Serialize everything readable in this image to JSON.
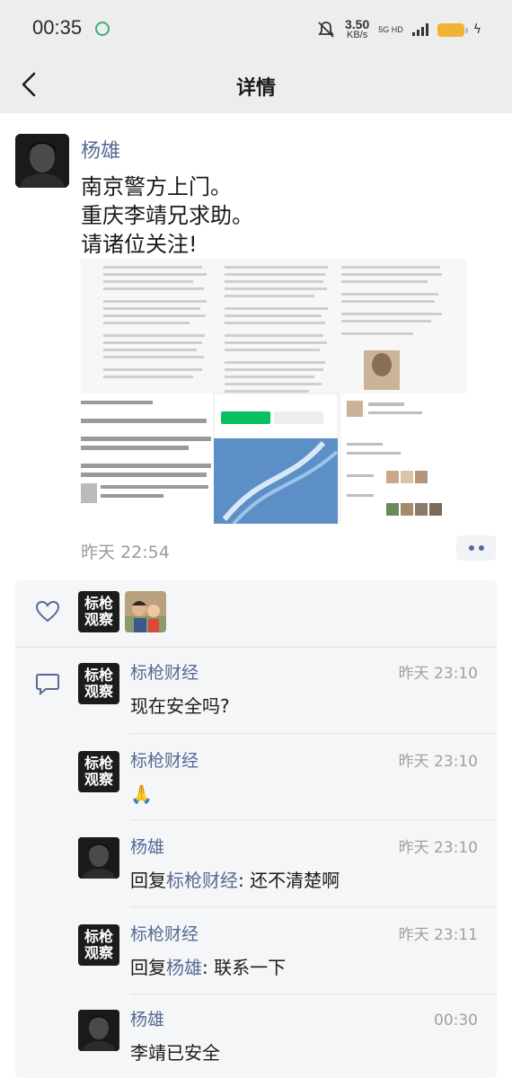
{
  "status_bar": {
    "time": "00:35",
    "net_speed": "3.50",
    "net_unit": "KB/s",
    "network": "5G HD"
  },
  "nav": {
    "title": "详情"
  },
  "post": {
    "author": "杨雄",
    "lines": [
      "南京警方上门。",
      "重庆李靖兄求助。",
      "请诸位关注!"
    ],
    "time": "昨天 22:54"
  },
  "likes": {
    "users": [
      "标枪观察",
      "family-photo"
    ]
  },
  "brand_avatar": {
    "line1": "标枪",
    "line2": "观察"
  },
  "comments": [
    {
      "author": "标枪财经",
      "time": "昨天 23:10",
      "text": "现在安全吗?",
      "avatar": "brand"
    },
    {
      "author": "标枪财经",
      "time": "昨天 23:10",
      "text": "🙏",
      "avatar": "brand"
    },
    {
      "author": "杨雄",
      "time": "昨天 23:10",
      "reply_prefix": "回复",
      "reply_to": "标枪财经",
      "reply_text": ": 还不清楚啊",
      "avatar": "photo"
    },
    {
      "author": "标枪财经",
      "time": "昨天 23:11",
      "reply_prefix": "回复",
      "reply_to": "杨雄",
      "reply_text": ": 联系一下",
      "avatar": "brand"
    },
    {
      "author": "杨雄",
      "time": "00:30",
      "text": "李靖已安全",
      "avatar": "photo"
    }
  ],
  "colors": {
    "link": "#576b95",
    "page_bg": "#ffffff",
    "bar_bg": "#ededed",
    "panel_bg": "#f5f6f7"
  },
  "icons": [
    "back-icon",
    "heart-icon",
    "comment-icon",
    "more-icon",
    "sync-icon",
    "mute-icon",
    "battery-icon"
  ]
}
